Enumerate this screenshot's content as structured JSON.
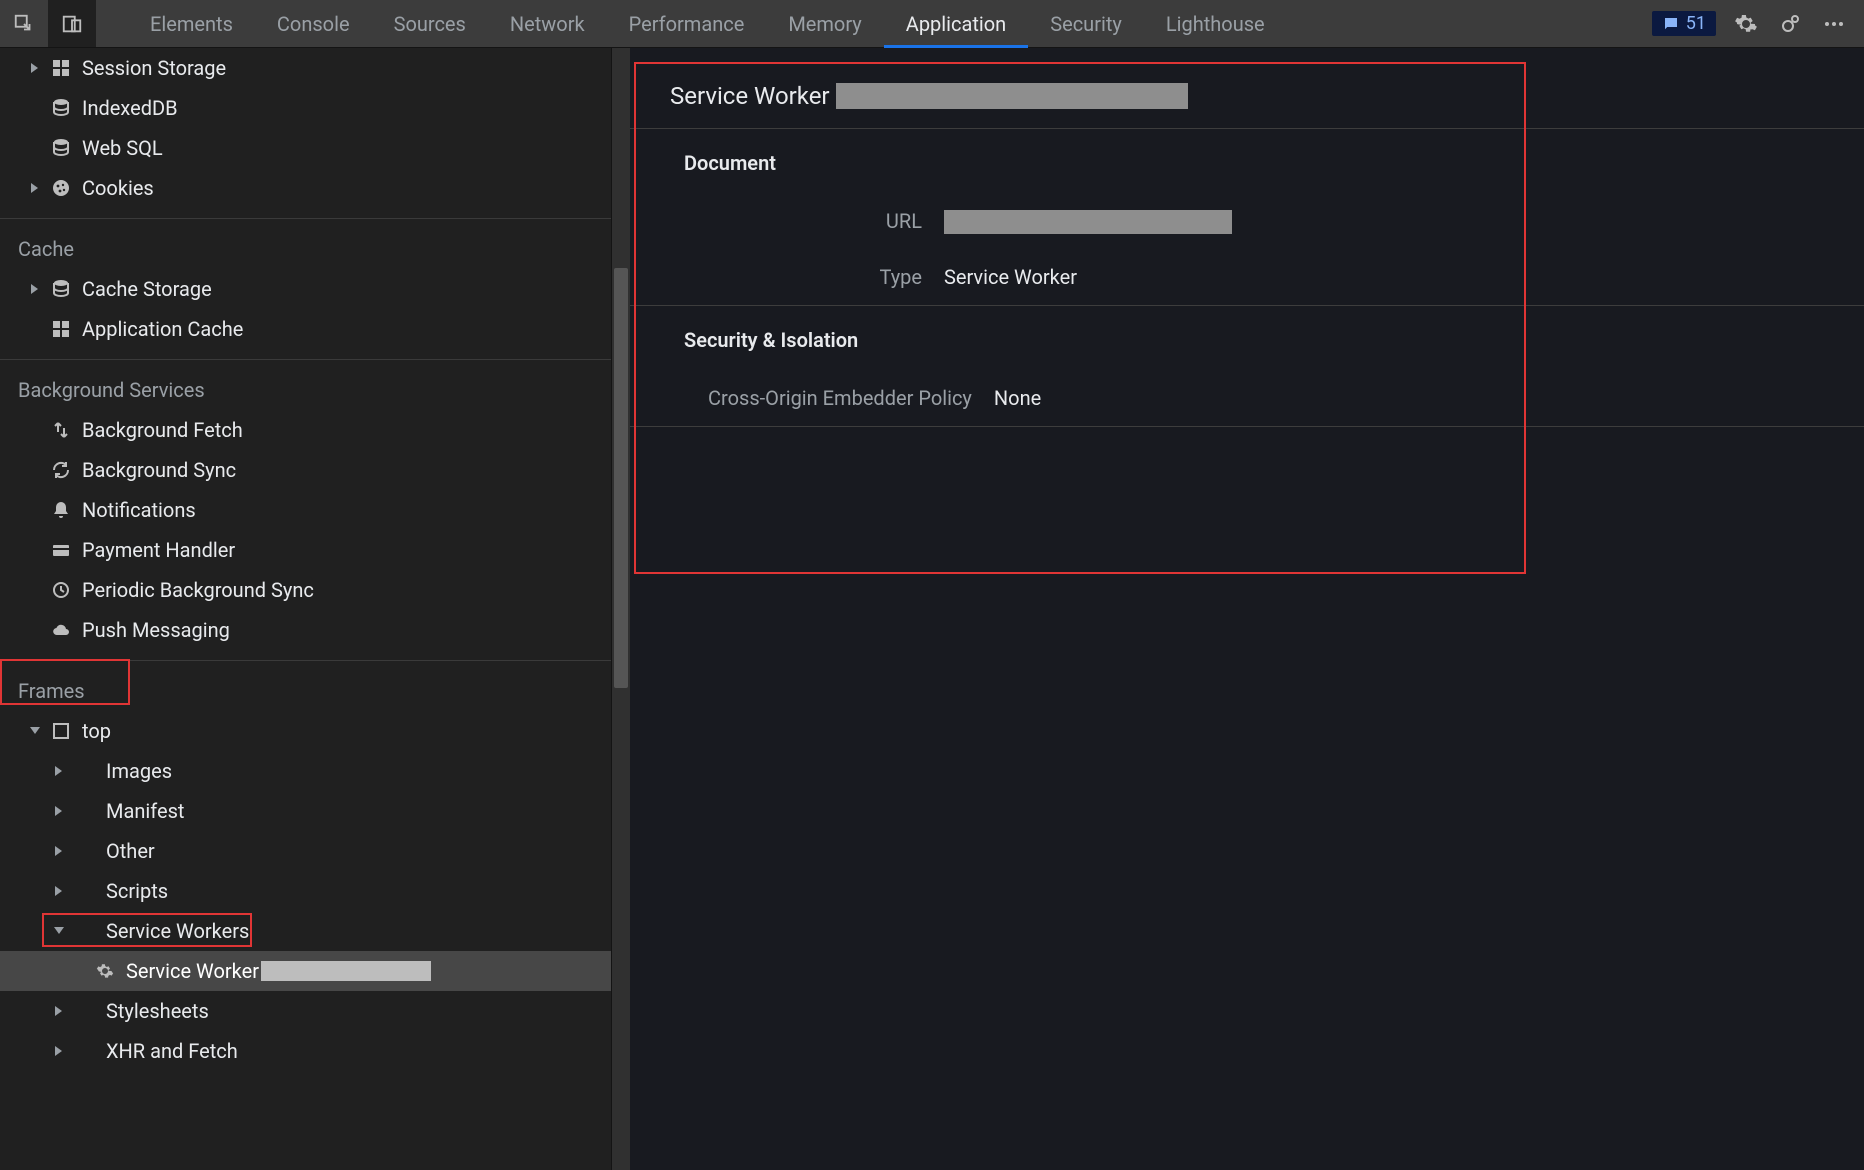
{
  "tabs": [
    "Elements",
    "Console",
    "Sources",
    "Network",
    "Performance",
    "Memory",
    "Application",
    "Security",
    "Lighthouse"
  ],
  "active_tab": "Application",
  "msg_count": "51",
  "sidebar": {
    "storage_items": [
      {
        "label": "Session Storage",
        "icon": "grid",
        "arrow": "closed",
        "depth": 1
      },
      {
        "label": "IndexedDB",
        "icon": "db",
        "arrow": "none",
        "depth": 1
      },
      {
        "label": "Web SQL",
        "icon": "db",
        "arrow": "none",
        "depth": 1
      },
      {
        "label": "Cookies",
        "icon": "cookie",
        "arrow": "closed",
        "depth": 1
      }
    ],
    "cache_title": "Cache",
    "cache_items": [
      {
        "label": "Cache Storage",
        "icon": "db",
        "arrow": "closed",
        "depth": 1
      },
      {
        "label": "Application Cache",
        "icon": "grid",
        "arrow": "none",
        "depth": 1
      }
    ],
    "bg_title": "Background Services",
    "bg_items": [
      {
        "label": "Background Fetch",
        "icon": "fetch",
        "arrow": "none",
        "depth": 1
      },
      {
        "label": "Background Sync",
        "icon": "sync",
        "arrow": "none",
        "depth": 1
      },
      {
        "label": "Notifications",
        "icon": "bell",
        "arrow": "none",
        "depth": 1
      },
      {
        "label": "Payment Handler",
        "icon": "card",
        "arrow": "none",
        "depth": 1
      },
      {
        "label": "Periodic Background Sync",
        "icon": "clock",
        "arrow": "none",
        "depth": 1
      },
      {
        "label": "Push Messaging",
        "icon": "cloud",
        "arrow": "none",
        "depth": 1
      }
    ],
    "frames_title": "Frames",
    "frames_items": [
      {
        "label": "top",
        "icon": "frame",
        "arrow": "open",
        "depth": 1
      },
      {
        "label": "Images",
        "icon": "",
        "arrow": "closed",
        "depth": 2
      },
      {
        "label": "Manifest",
        "icon": "",
        "arrow": "closed",
        "depth": 2
      },
      {
        "label": "Other",
        "icon": "",
        "arrow": "closed",
        "depth": 2
      },
      {
        "label": "Scripts",
        "icon": "",
        "arrow": "closed",
        "depth": 2
      },
      {
        "label": "Service Workers",
        "icon": "",
        "arrow": "open",
        "depth": 2,
        "swbox": true
      },
      {
        "label": "Service Worker",
        "icon": "gear",
        "arrow": "none",
        "depth": 3,
        "selected": true,
        "redact": true
      },
      {
        "label": "Stylesheets",
        "icon": "",
        "arrow": "closed",
        "depth": 2
      },
      {
        "label": "XHR and Fetch",
        "icon": "",
        "arrow": "closed",
        "depth": 2
      }
    ]
  },
  "detail": {
    "title": "Service Worker",
    "doc_section": "Document",
    "url_label": "URL",
    "type_label": "Type",
    "type_value": "Service Worker",
    "sec_section": "Security & Isolation",
    "coep_label": "Cross-Origin Embedder Policy",
    "coep_value": "None"
  }
}
